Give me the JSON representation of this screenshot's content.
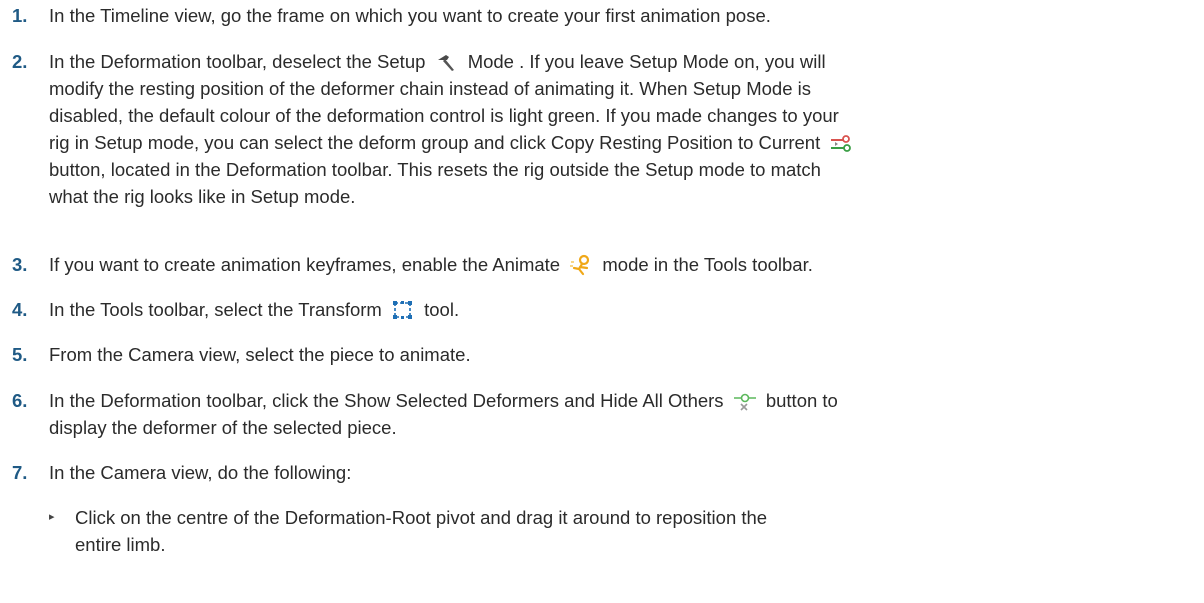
{
  "steps": [
    {
      "num": "1.",
      "text": "In the Timeline view, go the frame on which you want to create your first animation pose."
    },
    {
      "num": "2.",
      "a": "In the Deformation toolbar, deselect the Setup",
      "b": "Mode . If you leave Setup Mode on, you will",
      "l2": "modify the resting position of the deformer chain instead of animating it. When Setup Mode is",
      "l3": "disabled, the default colour of the deformation control is light green. If you made changes to your",
      "l4": "rig in Setup mode, you can select the deform group and click Copy Resting Position to Current",
      "l5": "button, located in the Deformation toolbar. This resets the rig outside the Setup mode to match",
      "l6": "what the rig looks like in Setup mode.",
      "icon1": "setup-mode-hammer-icon",
      "icon2": "copy-resting-position-icon"
    },
    {
      "num": "3.",
      "a": "If you want to create animation keyframes, enable the Animate",
      "b": "mode in the Tools toolbar.",
      "icon": "animate-mode-icon"
    },
    {
      "num": "4.",
      "a": "In the Tools toolbar, select the Transform",
      "b": "tool.",
      "icon": "transform-tool-icon"
    },
    {
      "num": "5.",
      "text": "From the Camera view, select the piece to animate."
    },
    {
      "num": "6.",
      "a": "In the Deformation toolbar, click the Show Selected Deformers and Hide All Others",
      "b": "button to",
      "l2": "display the deformer of the selected piece.",
      "icon": "show-selected-deformers-icon"
    },
    {
      "num": "7.",
      "text": "In the Camera view, do the following:"
    }
  ],
  "bullets": [
    {
      "mark": "▸",
      "l1": "Click on the centre of the Deformation-Root pivot and drag it around to reposition the",
      "l2": "entire limb."
    }
  ],
  "colors": {
    "step_number": "#1f5a85",
    "text": "#2b2b2b"
  }
}
